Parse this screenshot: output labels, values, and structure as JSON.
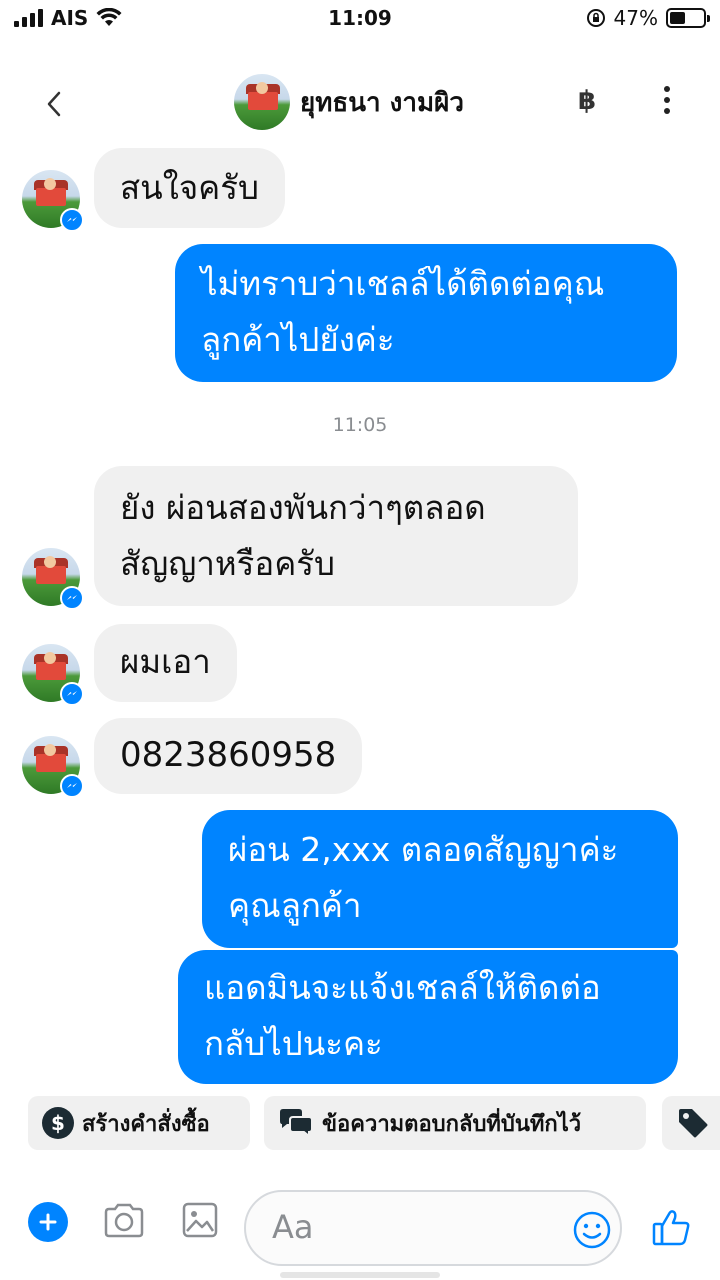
{
  "status_bar": {
    "carrier": "AIS",
    "time": "11:09",
    "battery_percent": "47%",
    "battery_level": 0.47
  },
  "header": {
    "contact_name": "ยุทธนา งามผิว",
    "currency_symbol": "฿"
  },
  "messages": [
    {
      "direction": "incoming",
      "text": "สนใจครับ"
    },
    {
      "direction": "outgoing",
      "lines": [
        "ไม่ทราบว่าเชลล์ได้ติดต่อคุณ",
        "ลูกค้าไปยังค่ะ"
      ]
    },
    {
      "direction": "incoming",
      "lines": [
        "ยัง  ผ่อนสองพันกว่าๆตลอด",
        "สัญญาหรือครับ"
      ]
    },
    {
      "direction": "incoming",
      "text": "ผมเอา"
    },
    {
      "direction": "incoming",
      "text": "0823860958"
    },
    {
      "direction": "outgoing",
      "lines": [
        "ผ่อน 2,xxx ตลอดสัญญาค่ะ",
        "คุณลูกค้า"
      ]
    },
    {
      "direction": "outgoing",
      "lines": [
        "แอดมินจะแจ้งเชลล์ให้ติดต่อ",
        "กลับไปนะคะ"
      ]
    }
  ],
  "timestamp": "11:05",
  "quick_replies": [
    {
      "label": "สร้างคำสั่งซื้อ",
      "icon": "dollar-icon",
      "glyph": "$"
    },
    {
      "label": "ข้อความตอบกลับที่บันทึกไว้",
      "icon": "chat-bubbles-icon"
    },
    {
      "label": "",
      "icon": "tag-icon"
    }
  ],
  "composer": {
    "placeholder": "Aa"
  },
  "colors": {
    "accent": "#0084ff",
    "incoming_bubble": "#f0f0f0",
    "timestamp": "#8a8d91"
  }
}
